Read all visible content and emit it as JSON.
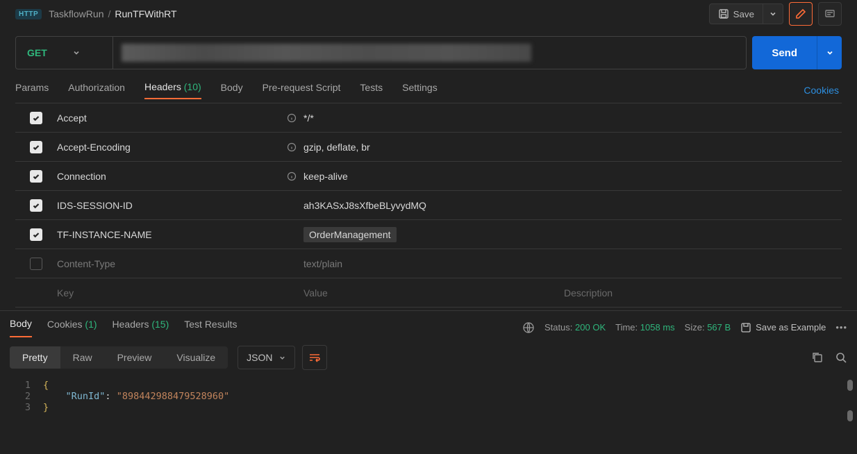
{
  "breadcrumb": {
    "badge": "HTTP",
    "parent": "TaskflowRun",
    "sep": "/",
    "current": "RunTFWithRT"
  },
  "actions": {
    "save": "Save"
  },
  "method": "GET",
  "send": "Send",
  "request_tabs": {
    "params": "Params",
    "authorization": "Authorization",
    "headers_label": "Headers",
    "headers_count": "(10)",
    "body": "Body",
    "prerequest": "Pre-request Script",
    "tests": "Tests",
    "settings": "Settings",
    "cookies": "Cookies"
  },
  "headers": [
    {
      "checked": true,
      "key": "Accept",
      "info": true,
      "value": "*/*",
      "desc": ""
    },
    {
      "checked": true,
      "key": "Accept-Encoding",
      "info": true,
      "value": "gzip, deflate, br",
      "desc": ""
    },
    {
      "checked": true,
      "key": "Connection",
      "info": true,
      "value": "keep-alive",
      "desc": ""
    },
    {
      "checked": true,
      "key": "IDS-SESSION-ID",
      "info": false,
      "value": "ah3KASxJ8sXfbeBLyvydMQ",
      "desc": ""
    },
    {
      "checked": true,
      "key": "TF-INSTANCE-NAME",
      "info": false,
      "value": "OrderManagement",
      "desc": "",
      "highlight": true
    },
    {
      "checked": false,
      "key": "Content-Type",
      "info": false,
      "value": "text/plain",
      "desc": "",
      "disabled": true
    }
  ],
  "headers_placeholder": {
    "key": "Key",
    "value": "Value",
    "desc": "Description"
  },
  "response_tabs": {
    "body": "Body",
    "cookies_label": "Cookies",
    "cookies_count": "(1)",
    "headers_label": "Headers",
    "headers_count": "(15)",
    "test_results": "Test Results"
  },
  "response_meta": {
    "status_label": "Status:",
    "status_value": "200 OK",
    "time_label": "Time:",
    "time_value": "1058 ms",
    "size_label": "Size:",
    "size_value": "567 B",
    "save_example": "Save as Example"
  },
  "body_view": {
    "pretty": "Pretty",
    "raw": "Raw",
    "preview": "Preview",
    "visualize": "Visualize",
    "format": "JSON"
  },
  "response_body": {
    "line1_no": "1",
    "line2_no": "2",
    "line3_no": "3",
    "brace_open": "{",
    "brace_close": "}",
    "key": "\"RunId\"",
    "colon": ": ",
    "val": "\"898442988479528960\""
  }
}
